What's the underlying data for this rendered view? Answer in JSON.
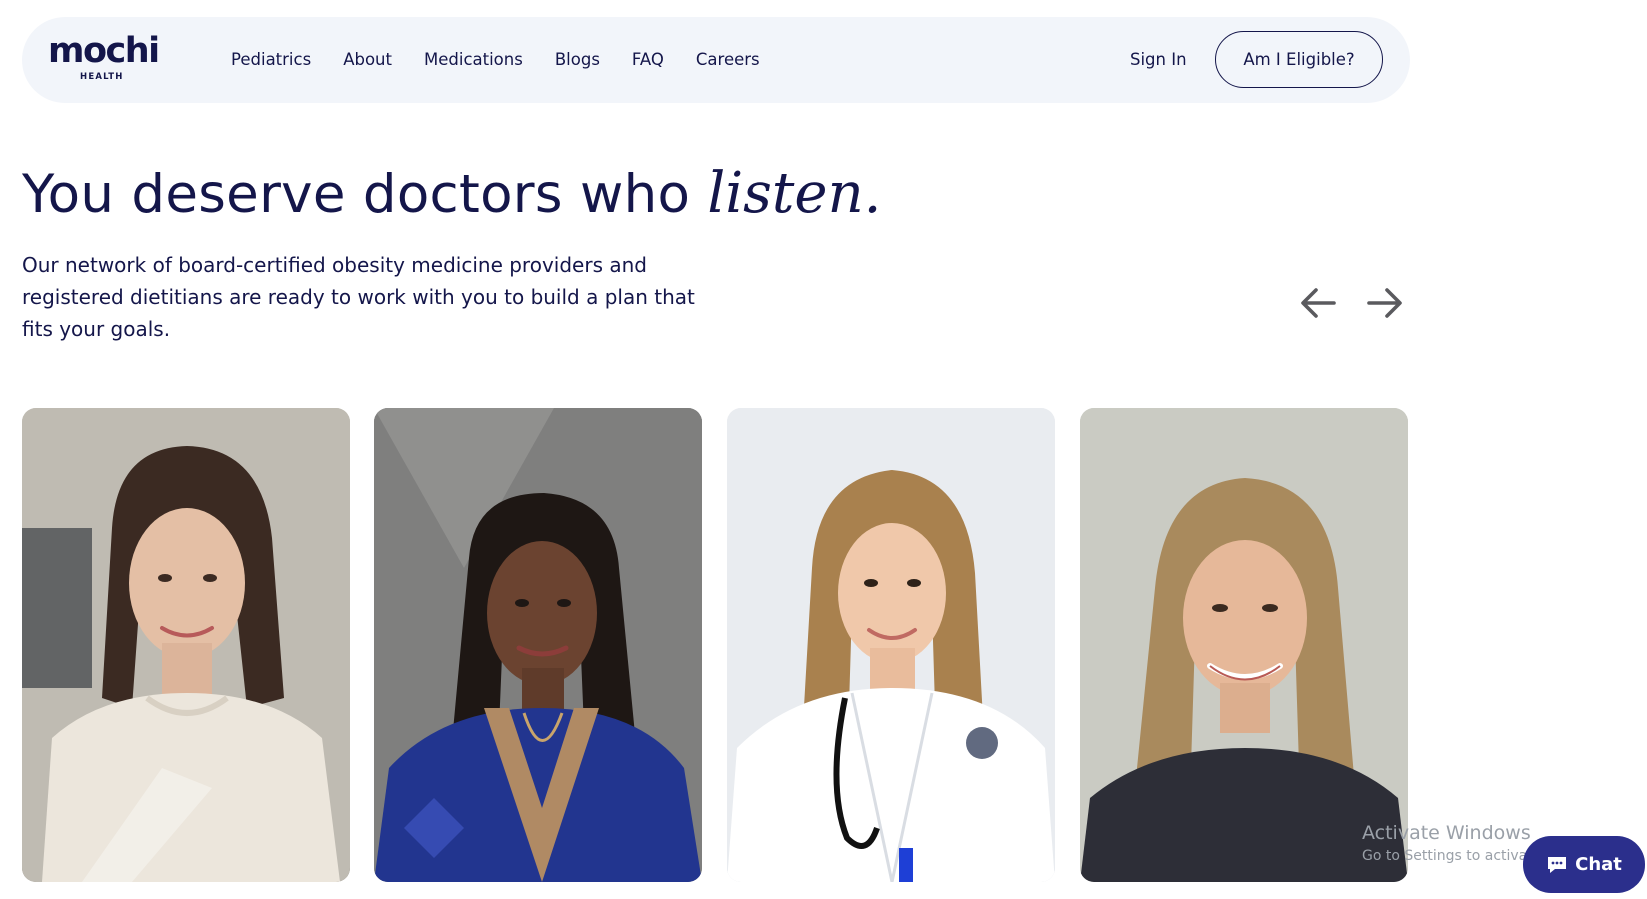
{
  "nav": {
    "logo_text": "mochi",
    "logo_subtext": "HEALTH",
    "links": [
      "Pediatrics",
      "About",
      "Medications",
      "Blogs",
      "FAQ",
      "Careers"
    ],
    "signin_label": "Sign In",
    "cta_label": "Am I Eligible?"
  },
  "hero": {
    "title_main": "You deserve doctors who ",
    "title_emphasis": "listen.",
    "description": "Our network of board-certified obesity medicine providers and registered dietitians are ready to work with you to build a plan that fits your goals."
  },
  "carousel": {
    "prev_icon": "arrow-left-icon",
    "next_icon": "arrow-right-icon",
    "cards": [
      {
        "alt": "provider-photo-1"
      },
      {
        "alt": "provider-photo-2"
      },
      {
        "alt": "provider-photo-3"
      },
      {
        "alt": "provider-photo-4"
      }
    ]
  },
  "watermark": {
    "title": "Activate Windows",
    "subtitle": "Go to Settings to activate Windows."
  },
  "chat": {
    "label": "Chat",
    "icon": "chat-bubble-icon"
  },
  "colors": {
    "brand_navy": "#14164a",
    "nav_bg": "#f2f5fa",
    "chat_bg": "#2b2f8c"
  }
}
